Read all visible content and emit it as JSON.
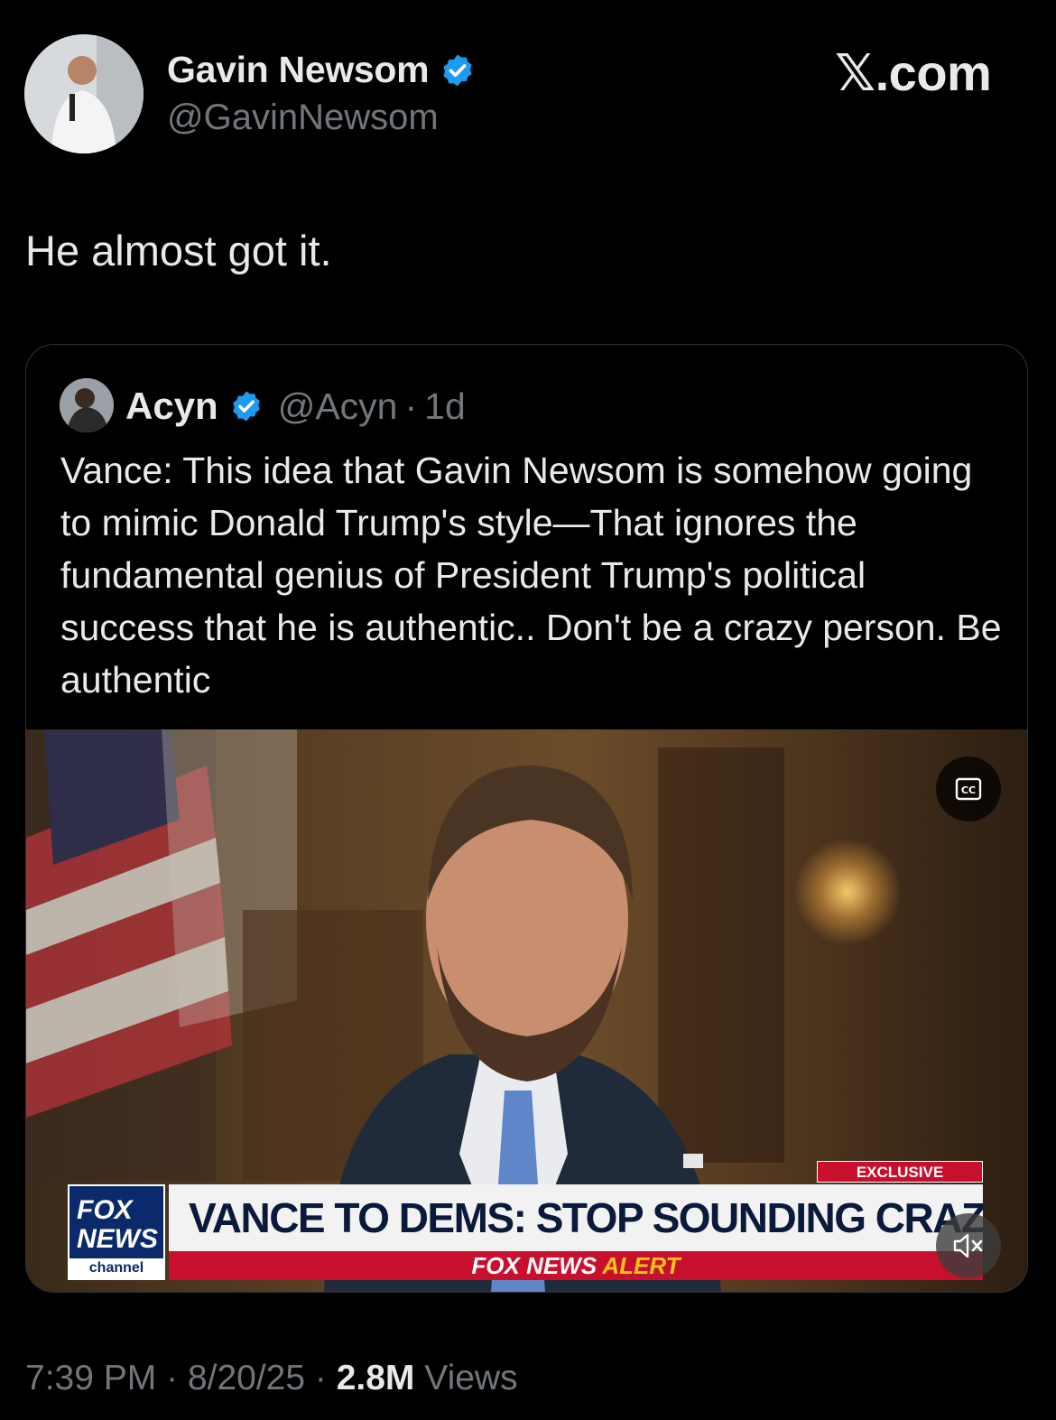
{
  "author": {
    "display_name": "Gavin Newsom",
    "handle": "@GavinNewsom",
    "verified_color": "#1d9bf0"
  },
  "watermark": "𝕏.com",
  "tweet": {
    "text": "He almost got it."
  },
  "quoted_tweet": {
    "display_name": "Acyn",
    "handle": "@Acyn",
    "separator": "·",
    "age": "1d",
    "text": "Vance: This idea that Gavin Newsom is somehow going to mimic Donald Trump's style—That ignores the fundamental genius of President Trump's political success that he is authentic.. Don't be a crazy person. Be authentic",
    "video": {
      "captions_icon": "cc-icon",
      "mute_icon": "speaker-muted-icon",
      "lower_third": {
        "tag": "EXCLUSIVE",
        "headline": "VANCE TO DEMS: STOP SOUNDING CRAZY",
        "alert_prefix": "FOX NEWS",
        "alert_suffix": "ALERT",
        "logo_line1": "FOX",
        "logo_line2": "NEWS",
        "logo_line3": "channel"
      }
    }
  },
  "meta": {
    "time": "7:39 PM",
    "date": "8/20/25",
    "views_count": "2.8M",
    "views_label": "Views"
  }
}
